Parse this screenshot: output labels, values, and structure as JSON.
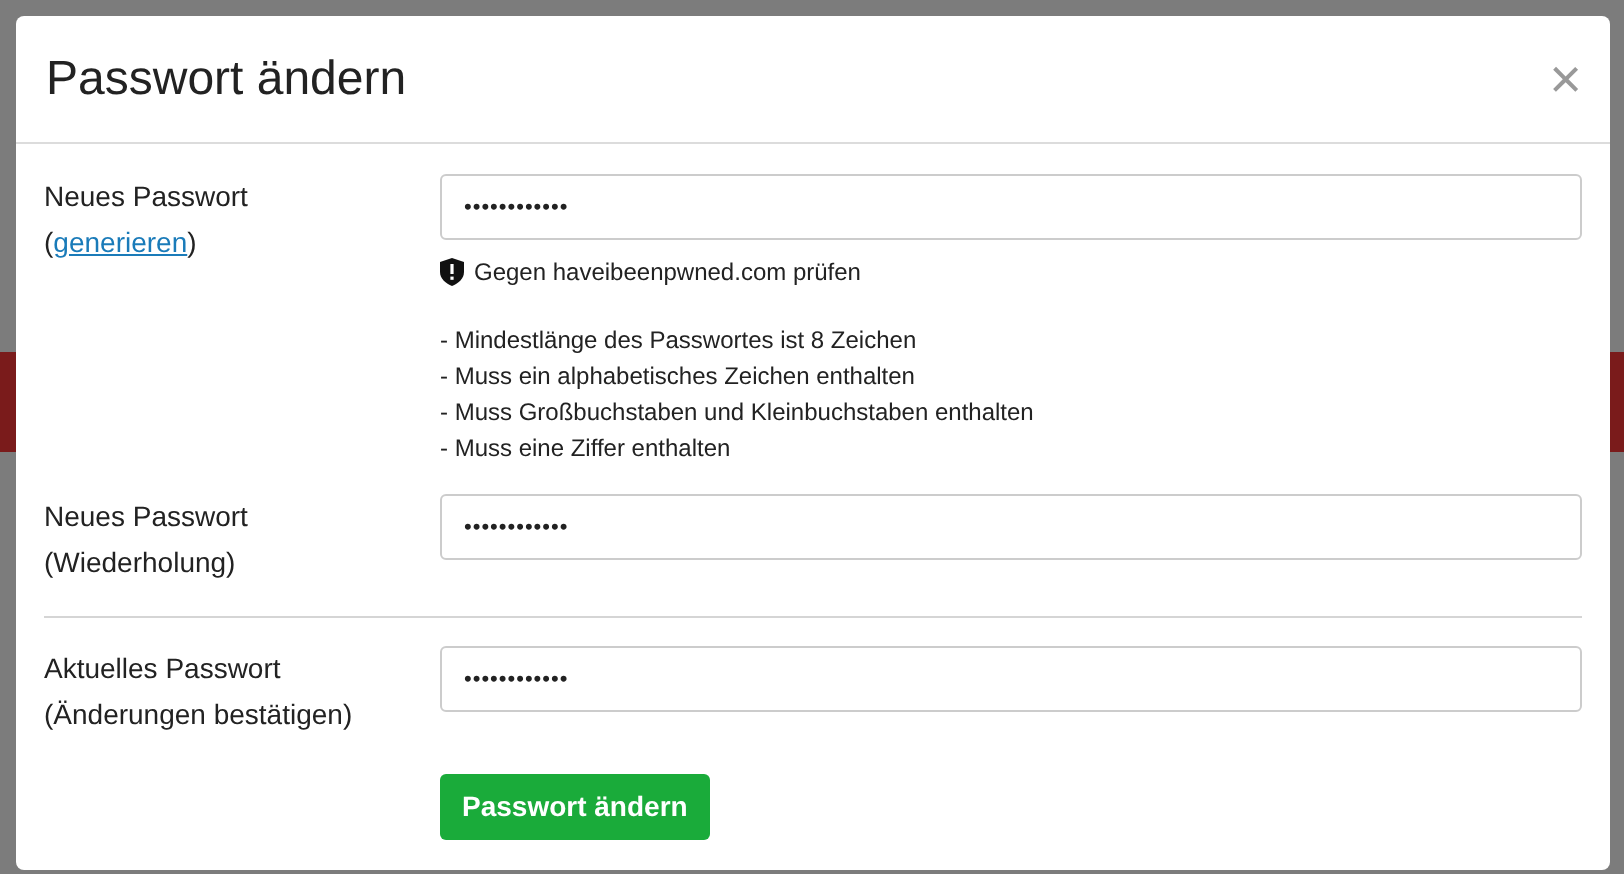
{
  "dialog": {
    "title": "Passwort ändern",
    "close": "×"
  },
  "fields": [
    {
      "label": "Neues Passwort",
      "sublabel_prefix": "(",
      "link": "generieren",
      "sublabel_suffix": ")",
      "value": "••••••••••••",
      "check": "Gegen haveibeenpwned.com prüfen",
      "rules": [
        "- Mindestlänge des Passwortes ist 8 Zeichen",
        "- Muss ein alphabetisches Zeichen enthalten",
        "- Muss Großbuchstaben und Kleinbuchstaben enthalten",
        "- Muss eine Ziffer enthalten"
      ]
    },
    {
      "label": "Neues Passwort",
      "sublabel_prefix": "(Wiederholung)",
      "value": "••••••••••••",
      "divider_after": true
    },
    {
      "label": "Aktuelles Passwort",
      "sublabel_prefix": "(Änderungen bestätigen)",
      "value": "••••••••••••"
    }
  ],
  "submit": "Passwort ändern"
}
